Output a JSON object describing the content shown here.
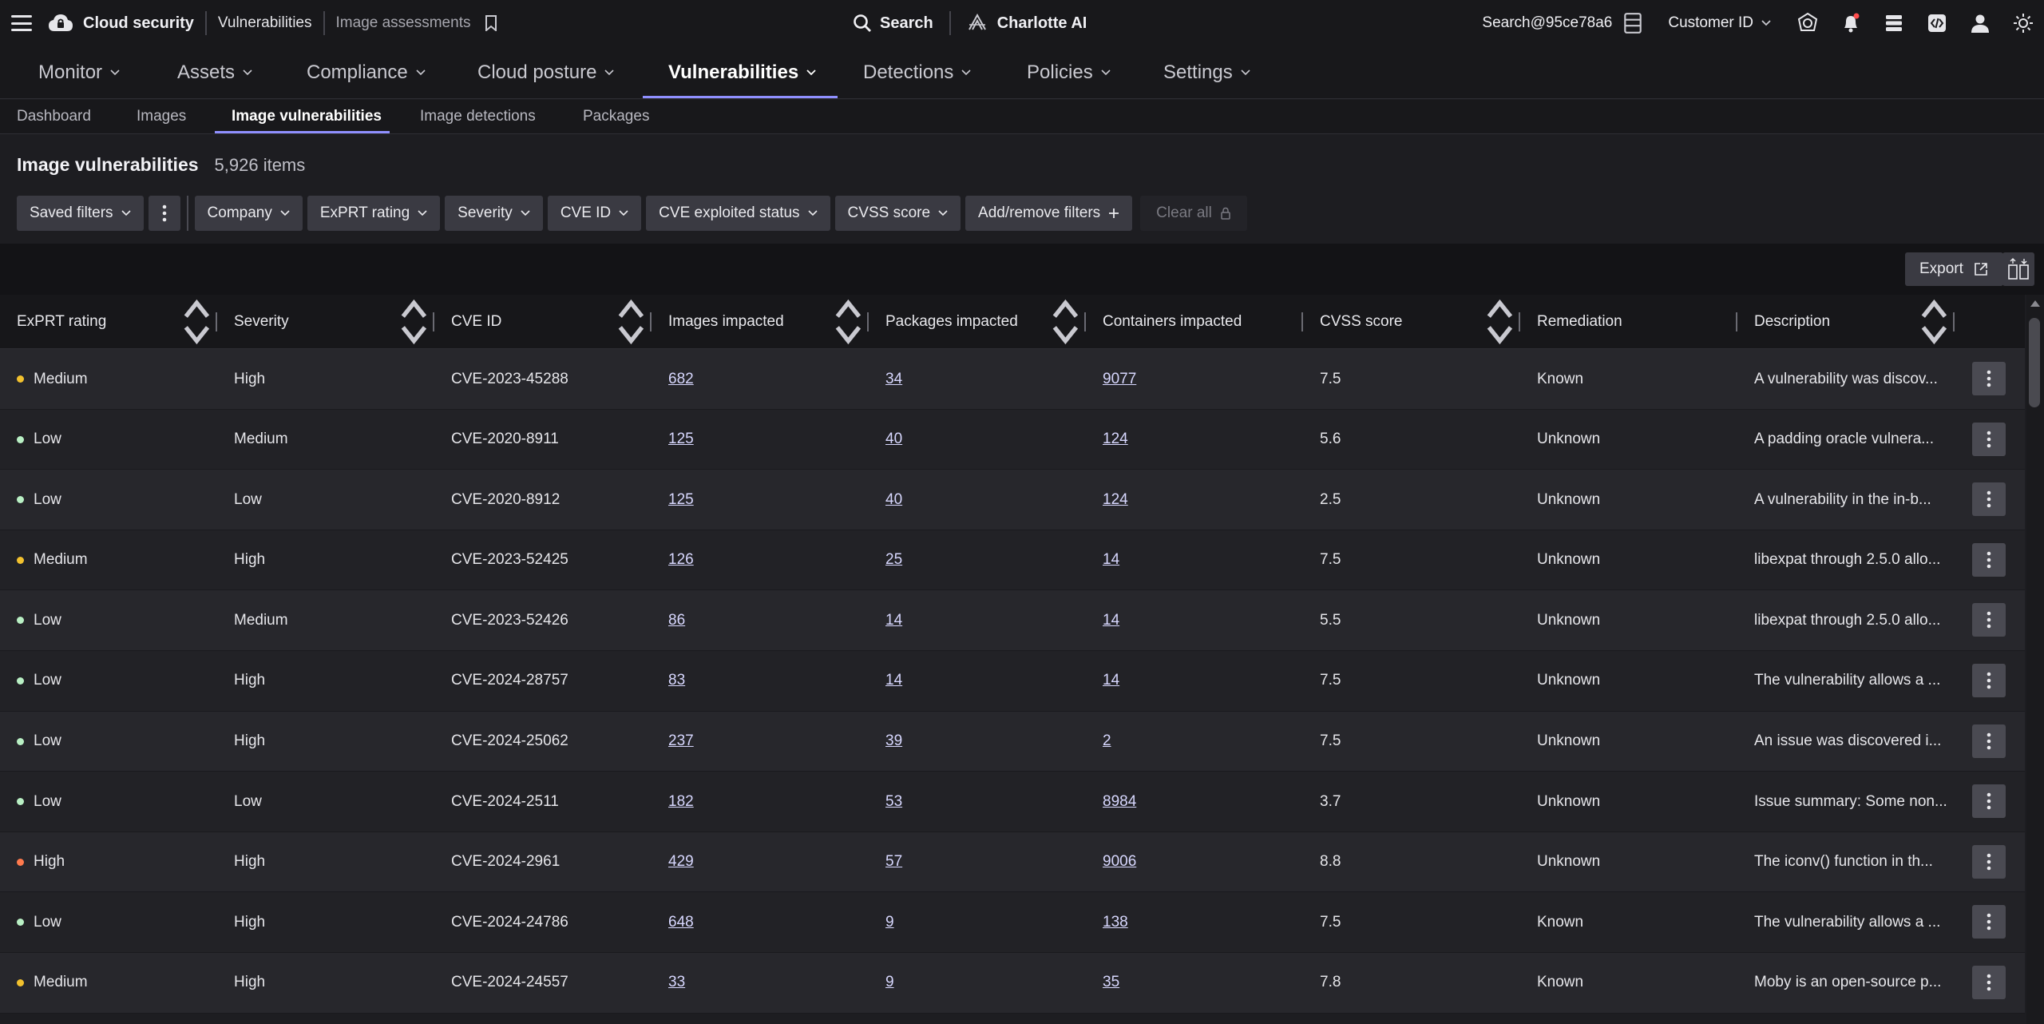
{
  "topbar": {
    "brand": "Cloud security",
    "crumb1": "Vulnerabilities",
    "crumb2": "Image assessments",
    "search_label": "Search",
    "ai_label": "Charlotte AI",
    "account": "Search@95ce78a6",
    "customer_label": "Customer ID"
  },
  "mainnav": [
    {
      "label": "Monitor"
    },
    {
      "label": "Assets"
    },
    {
      "label": "Compliance"
    },
    {
      "label": "Cloud posture"
    },
    {
      "label": "Vulnerabilities"
    },
    {
      "label": "Detections"
    },
    {
      "label": "Policies"
    },
    {
      "label": "Settings"
    }
  ],
  "subnav": [
    {
      "label": "Dashboard"
    },
    {
      "label": "Images"
    },
    {
      "label": "Image vulnerabilities"
    },
    {
      "label": "Image detections"
    },
    {
      "label": "Packages"
    }
  ],
  "page": {
    "title": "Image vulnerabilities",
    "count": "5,926 items"
  },
  "filters": {
    "saved": "Saved filters",
    "company": "Company",
    "exprt": "ExPRT rating",
    "severity": "Severity",
    "cve_id": "CVE ID",
    "cve_exploited": "CVE exploited status",
    "cvss": "CVSS score",
    "add_remove": "Add/remove filters",
    "clear_all": "Clear all"
  },
  "toolbar": {
    "export": "Export"
  },
  "colors": {
    "accent": "#8f8fff",
    "medium": "#f2c12e",
    "low": "#b9f0c4",
    "high": "#ff7a4d"
  },
  "columns": [
    "ExPRT rating",
    "Severity",
    "CVE ID",
    "Images impacted",
    "Packages impacted",
    "Containers impacted",
    "CVSS score",
    "Remediation",
    "Description"
  ],
  "rows": [
    {
      "exprt": "Medium",
      "severity": "High",
      "cve": "CVE-2023-45288",
      "images": "682",
      "packages": "34",
      "containers": "9077",
      "cvss": "7.5",
      "remediation": "Known",
      "description": "A vulnerability was discov..."
    },
    {
      "exprt": "Low",
      "severity": "Medium",
      "cve": "CVE-2020-8911",
      "images": "125",
      "packages": "40",
      "containers": "124",
      "cvss": "5.6",
      "remediation": "Unknown",
      "description": "A padding oracle vulnera..."
    },
    {
      "exprt": "Low",
      "severity": "Low",
      "cve": "CVE-2020-8912",
      "images": "125",
      "packages": "40",
      "containers": "124",
      "cvss": "2.5",
      "remediation": "Unknown",
      "description": "A vulnerability in the in-b..."
    },
    {
      "exprt": "Medium",
      "severity": "High",
      "cve": "CVE-2023-52425",
      "images": "126",
      "packages": "25",
      "containers": "14",
      "cvss": "7.5",
      "remediation": "Unknown",
      "description": "libexpat through 2.5.0 allo..."
    },
    {
      "exprt": "Low",
      "severity": "Medium",
      "cve": "CVE-2023-52426",
      "images": "86",
      "packages": "14",
      "containers": "14",
      "cvss": "5.5",
      "remediation": "Unknown",
      "description": "libexpat through 2.5.0 allo..."
    },
    {
      "exprt": "Low",
      "severity": "High",
      "cve": "CVE-2024-28757",
      "images": "83",
      "packages": "14",
      "containers": "14",
      "cvss": "7.5",
      "remediation": "Unknown",
      "description": "The vulnerability allows a ..."
    },
    {
      "exprt": "Low",
      "severity": "High",
      "cve": "CVE-2024-25062",
      "images": "237",
      "packages": "39",
      "containers": "2",
      "cvss": "7.5",
      "remediation": "Unknown",
      "description": "An issue was discovered i..."
    },
    {
      "exprt": "Low",
      "severity": "Low",
      "cve": "CVE-2024-2511",
      "images": "182",
      "packages": "53",
      "containers": "8984",
      "cvss": "3.7",
      "remediation": "Unknown",
      "description": "Issue summary: Some non..."
    },
    {
      "exprt": "High",
      "severity": "High",
      "cve": "CVE-2024-2961",
      "images": "429",
      "packages": "57",
      "containers": "9006",
      "cvss": "8.8",
      "remediation": "Unknown",
      "description": "The iconv() function in th..."
    },
    {
      "exprt": "Low",
      "severity": "High",
      "cve": "CVE-2024-24786",
      "images": "648",
      "packages": "9",
      "containers": "138",
      "cvss": "7.5",
      "remediation": "Known",
      "description": "The vulnerability allows a ..."
    },
    {
      "exprt": "Medium",
      "severity": "High",
      "cve": "CVE-2024-24557",
      "images": "33",
      "packages": "9",
      "containers": "35",
      "cvss": "7.8",
      "remediation": "Known",
      "description": "Moby is an open-source p..."
    }
  ]
}
